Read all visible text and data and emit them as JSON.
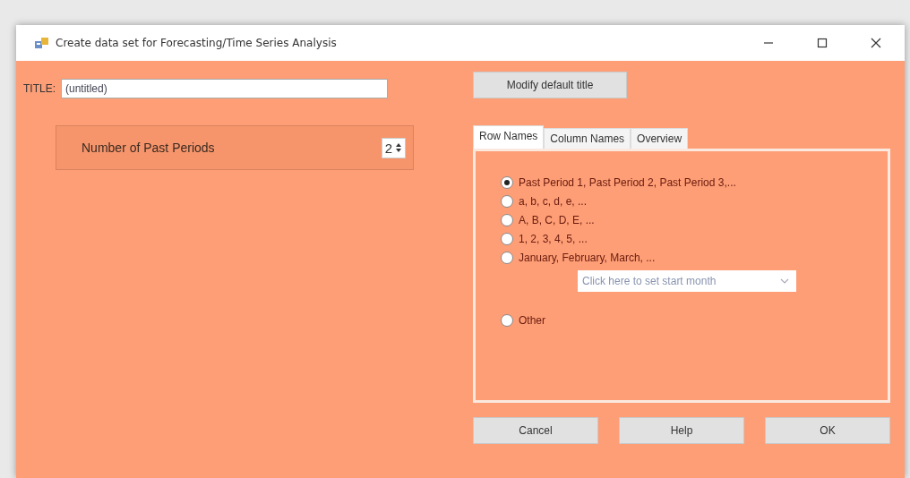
{
  "window": {
    "title": "Create data set for Forecasting/Time Series Analysis"
  },
  "title_field": {
    "label": "TITLE:",
    "value": "(untitled)"
  },
  "periods": {
    "label": "Number of Past Periods",
    "value": "2"
  },
  "modify_button": "Modify default title",
  "tabs": [
    {
      "label": "Row Names",
      "selected": true
    },
    {
      "label": "Column Names",
      "selected": false
    },
    {
      "label": "Overview",
      "selected": false
    }
  ],
  "options": [
    {
      "label": "Past Period 1, Past Period 2, Past Period 3,...",
      "selected": true
    },
    {
      "label": "a, b, c, d, e, ...",
      "selected": false
    },
    {
      "label": "A, B, C, D, E, ...",
      "selected": false
    },
    {
      "label": "1, 2, 3, 4, 5, ...",
      "selected": false
    },
    {
      "label": "January, February, March, ...",
      "selected": false,
      "month_picker": {
        "placeholder": "Click here to set start month"
      }
    },
    {
      "label": "Other",
      "selected": false
    }
  ],
  "buttons": [
    "Cancel",
    "Help",
    "OK"
  ]
}
